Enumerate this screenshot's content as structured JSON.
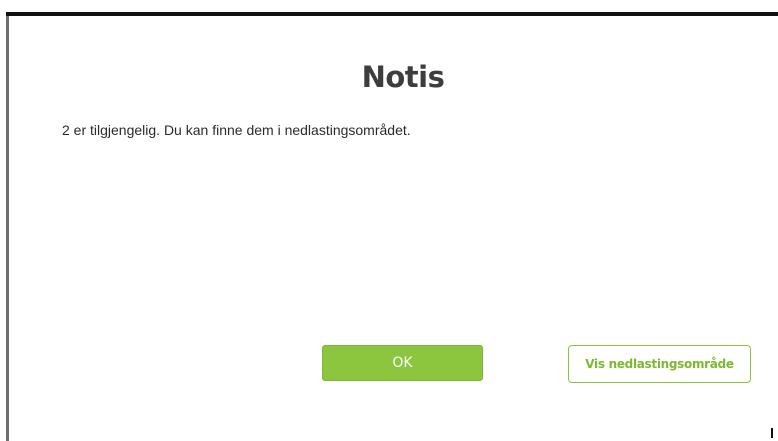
{
  "dialog": {
    "title": "Notis",
    "message": "2 er tilgjengelig. Du kan finne dem i nedlastingsområdet.",
    "ok_label": "OK",
    "show_downloads_label": "Vis nedlastingsområde"
  },
  "colors": {
    "accent": "#8cc63f",
    "title_text": "#3d3d3d",
    "body_text": "#2b2b2b"
  }
}
